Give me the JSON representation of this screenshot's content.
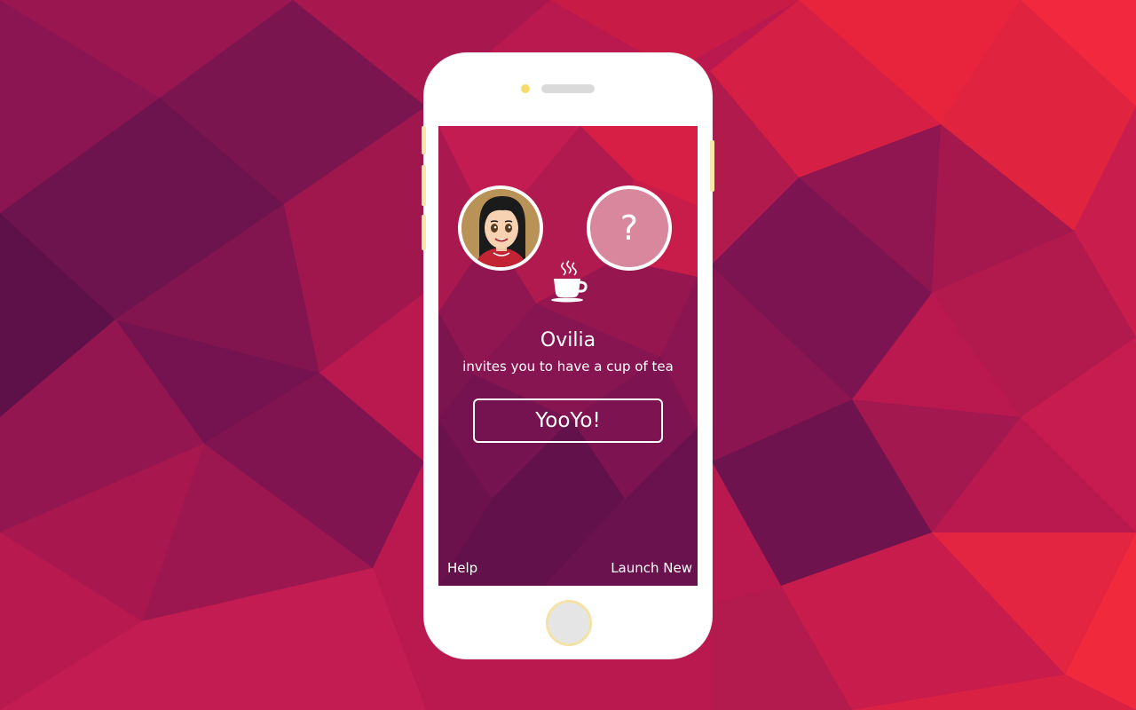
{
  "colors": {
    "background_primary": "#c01c52",
    "background_accent": "#f2283d",
    "background_dark": "#7a1550",
    "phone_body": "#ffffff",
    "phone_trim": "#f7e7a9",
    "camera": "#f6db6b",
    "avatar_unknown": "#d9879c"
  },
  "invite": {
    "inviter_avatar_icon": "girl-avatar-icon",
    "invitee_placeholder": "?",
    "drink_icon": "steaming-teacup-icon",
    "inviter_name": "Ovilia",
    "message": "invites you to have a cup of tea",
    "accept_label": "YooYo!"
  },
  "footer": {
    "help_label": "Help",
    "launch_label": "Launch New"
  }
}
